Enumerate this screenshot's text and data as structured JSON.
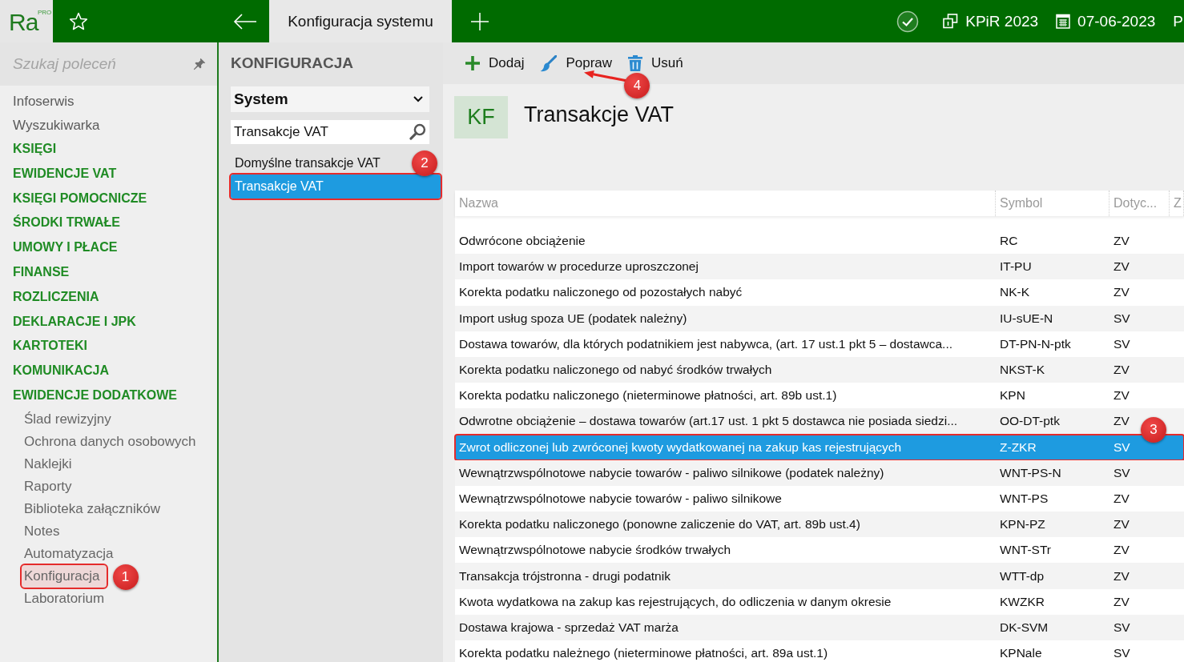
{
  "logo": {
    "text": "Ra",
    "badge": "PRO"
  },
  "topbar": {
    "tab": {
      "label": "Konfiguracja systemu",
      "selected": true
    },
    "items": [
      {
        "kind": "book",
        "label": "KPiR 2023"
      },
      {
        "kind": "calendar",
        "label": "07-06-2023"
      },
      {
        "kind": "text",
        "label": "P"
      }
    ]
  },
  "sidebar": {
    "search": {
      "placeholder": "Szukaj poleceń"
    },
    "items": [
      {
        "kind": "link",
        "label": "Infoserwis"
      },
      {
        "kind": "link",
        "label": "Wyszukiwarka"
      },
      {
        "kind": "section",
        "label": "KSIĘGI"
      },
      {
        "kind": "section",
        "label": "EWIDENCJE VAT"
      },
      {
        "kind": "section",
        "label": "KSIĘGI POMOCNICZE"
      },
      {
        "kind": "section",
        "label": "ŚRODKI TRWAŁE"
      },
      {
        "kind": "section",
        "label": "UMOWY I PŁACE"
      },
      {
        "kind": "section",
        "label": "FINANSE"
      },
      {
        "kind": "section",
        "label": "ROZLICZENIA"
      },
      {
        "kind": "section",
        "label": "DEKLARACJE I JPK"
      },
      {
        "kind": "section",
        "label": "KARTOTEKI"
      },
      {
        "kind": "section",
        "label": "KOMUNIKACJA"
      },
      {
        "kind": "section",
        "label": "EWIDENCJE DODATKOWE",
        "children": [
          {
            "label": "Ślad rewizyjny"
          },
          {
            "label": "Ochrona danych osobowych"
          },
          {
            "label": "Naklejki"
          },
          {
            "label": "Raporty"
          },
          {
            "label": "Biblioteka załączników"
          },
          {
            "label": "Notes"
          },
          {
            "label": "Automatyzacja"
          },
          {
            "label": "Konfiguracja",
            "annotation": "1"
          },
          {
            "label": "Laboratorium"
          }
        ]
      }
    ]
  },
  "panel": {
    "title": "KONFIGURACJA",
    "dropdown": {
      "value": "System"
    },
    "search": {
      "value": "Transakcje VAT"
    },
    "items": [
      {
        "label": "Domyślne transakcje VAT",
        "selected": false
      },
      {
        "label": "Transakcje VAT",
        "selected": true,
        "annotation": "2"
      }
    ]
  },
  "toolbar": {
    "buttons": [
      {
        "kind": "add",
        "label": "Dodaj"
      },
      {
        "kind": "edit",
        "label": "Popraw",
        "annotation": "4"
      },
      {
        "kind": "delete",
        "label": "Usuń"
      }
    ]
  },
  "header": {
    "badge": "KF",
    "title": "Transakcje VAT"
  },
  "table": {
    "columns": [
      "Nazwa",
      "Symbol",
      "Dotyc...",
      "Z"
    ],
    "rows": [
      {
        "cells": [
          "Odwrócone obciążenie",
          "RC",
          "ZV"
        ],
        "selected": false
      },
      {
        "cells": [
          "Import towarów w procedurze uproszczonej",
          "IT-PU",
          "ZV"
        ],
        "selected": false
      },
      {
        "cells": [
          "Korekta podatku naliczonego od pozostałych nabyć",
          "NK-K",
          "ZV"
        ],
        "selected": false
      },
      {
        "cells": [
          "Import usług spoza UE (podatek należny)",
          "IU-sUE-N",
          "SV"
        ],
        "selected": false
      },
      {
        "cells": [
          "Dostawa towarów, dla których podatnikiem jest nabywca, (art. 17 ust.1 pkt 5 – dostawca...",
          "DT-PN-N-ptk",
          "SV"
        ],
        "selected": false
      },
      {
        "cells": [
          "Korekta podatku naliczonego od nabyć środków trwałych",
          "NKST-K",
          "ZV"
        ],
        "selected": false
      },
      {
        "cells": [
          "Korekta podatku naliczonego (nieterminowe płatności, art. 89b ust.1)",
          "KPN",
          "ZV"
        ],
        "selected": false
      },
      {
        "cells": [
          "Odwrotne obciążenie – dostawa towarów (art.17 ust. 1 pkt 5 dostawca nie posiada siedzi...",
          "OO-DT-ptk",
          "ZV"
        ],
        "selected": false
      },
      {
        "cells": [
          "Zwrot odliczonej lub zwróconej kwoty wydatkowanej na zakup kas rejestrujących",
          "Z-ZKR",
          "SV"
        ],
        "selected": true,
        "annotation": "3"
      },
      {
        "cells": [
          "Wewnątrzwspólnotowe nabycie towarów - paliwo silnikowe (podatek należny)",
          "WNT-PS-N",
          "SV"
        ],
        "selected": false
      },
      {
        "cells": [
          "Wewnątrzwspólnotowe nabycie towarów - paliwo silnikowe",
          "WNT-PS",
          "ZV"
        ],
        "selected": false
      },
      {
        "cells": [
          "Korekta podatku naliczonego (ponowne zaliczenie do VAT, art. 89b ust.4)",
          "KPN-PZ",
          "ZV"
        ],
        "selected": false
      },
      {
        "cells": [
          "Wewnątrzwspólnotowe nabycie środków trwałych",
          "WNT-STr",
          "ZV"
        ],
        "selected": false
      },
      {
        "cells": [
          "Transakcja trójstronna - drugi podatnik",
          "WTT-dp",
          "ZV"
        ],
        "selected": false
      },
      {
        "cells": [
          "Kwota wydatkowa na zakup kas rejestrujących, do odliczenia w danym okresie",
          "KWZKR",
          "ZV"
        ],
        "selected": false
      },
      {
        "cells": [
          "Dostawa krajowa - sprzedaż VAT marża",
          "DK-SVM",
          "SV"
        ],
        "selected": false
      },
      {
        "cells": [
          "Korekta podatku należnego (nieterminowe płatności, art. 89a ust.1)",
          "KPNale",
          "SV"
        ],
        "selected": false
      }
    ]
  }
}
